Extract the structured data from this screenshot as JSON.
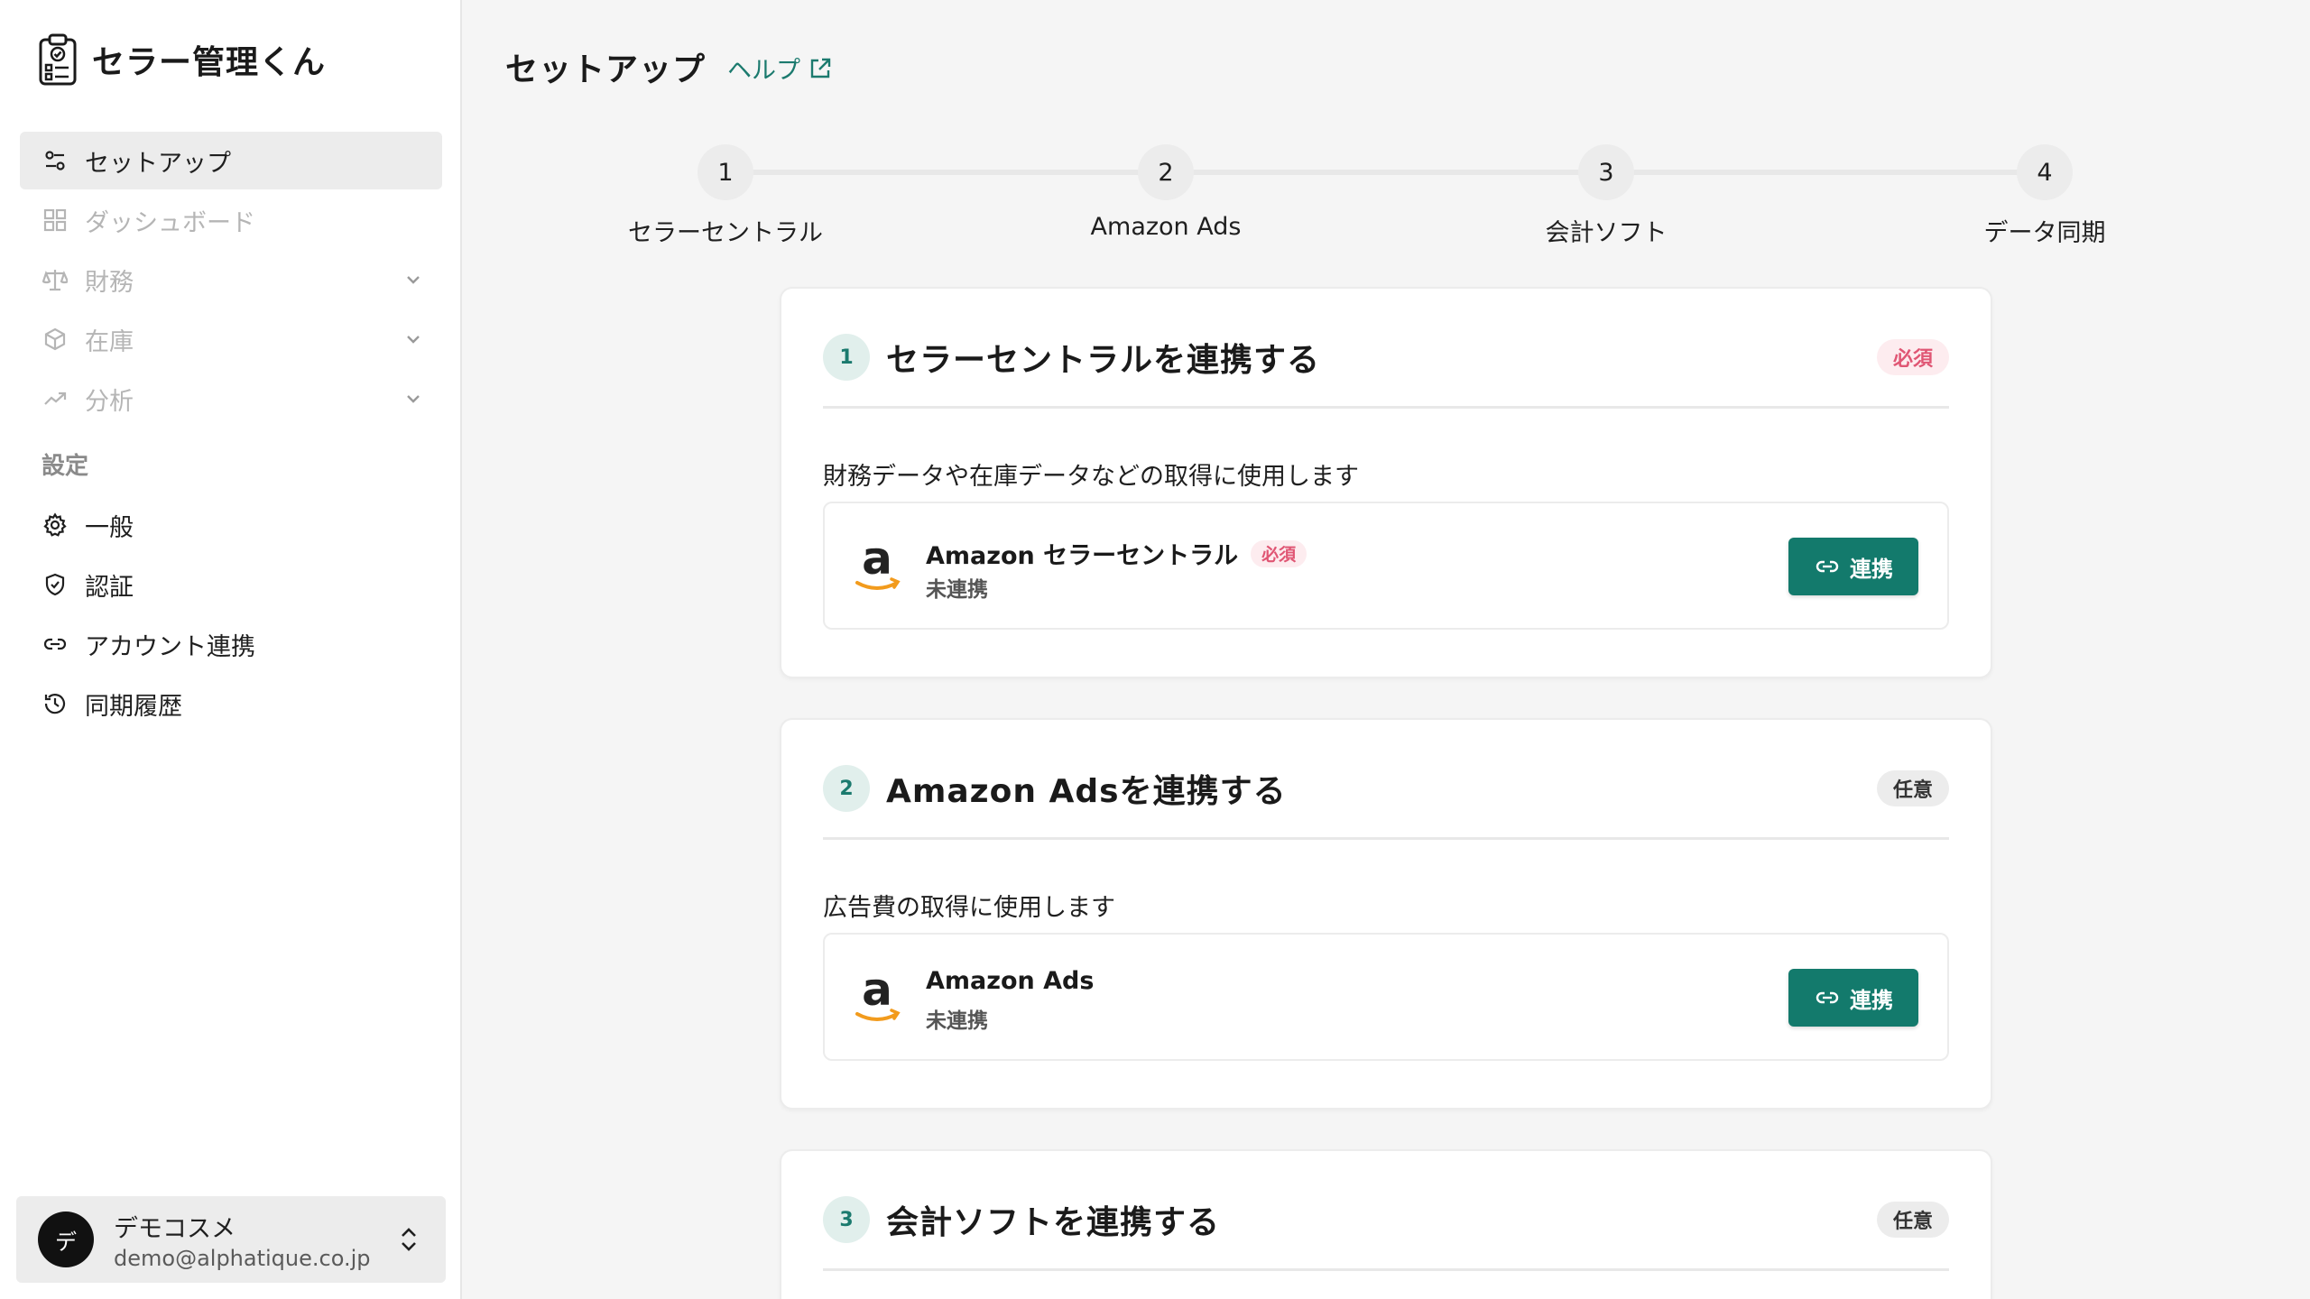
{
  "app": {
    "name": "セラー管理くん"
  },
  "sidebar": {
    "items": [
      {
        "label": "セットアップ",
        "icon": "sliders-icon",
        "state": "active"
      },
      {
        "label": "ダッシュボード",
        "icon": "grid-icon",
        "state": "disabled"
      },
      {
        "label": "財務",
        "icon": "scale-icon",
        "state": "disabled",
        "expandable": true
      },
      {
        "label": "在庫",
        "icon": "box-icon",
        "state": "disabled",
        "expandable": true
      },
      {
        "label": "分析",
        "icon": "trend-icon",
        "state": "disabled",
        "expandable": true
      }
    ],
    "settings_label": "設定",
    "settings_items": [
      {
        "label": "一般",
        "icon": "gear-icon"
      },
      {
        "label": "認証",
        "icon": "shield-icon"
      },
      {
        "label": "アカウント連携",
        "icon": "link-icon"
      },
      {
        "label": "同期履歴",
        "icon": "history-icon"
      }
    ],
    "user": {
      "avatar_initial": "デ",
      "name": "デモコスメ",
      "email": "demo@alphatique.co.jp"
    }
  },
  "header": {
    "title": "セットアップ",
    "help_label": "ヘルプ"
  },
  "stepper": {
    "steps": [
      {
        "number": "1",
        "label": "セラーセントラル"
      },
      {
        "number": "2",
        "label": "Amazon Ads"
      },
      {
        "number": "3",
        "label": "会計ソフト"
      },
      {
        "number": "4",
        "label": "データ同期"
      }
    ]
  },
  "cards": [
    {
      "number": "1",
      "title": "セラーセントラルを連携する",
      "badge": "必須",
      "badge_type": "required",
      "description": "財務データや在庫データなどの取得に使用します",
      "service": {
        "name": "Amazon セラーセントラル",
        "badge": "必須",
        "status": "未連携",
        "button_label": "連携"
      }
    },
    {
      "number": "2",
      "title": "Amazon Adsを連携する",
      "badge": "任意",
      "badge_type": "optional",
      "description": "広告費の取得に使用します",
      "service": {
        "name": "Amazon Ads",
        "status": "未連携",
        "button_label": "連携"
      }
    },
    {
      "number": "3",
      "title": "会計ソフトを連携する",
      "badge": "任意",
      "badge_type": "optional"
    }
  ],
  "colors": {
    "accent": "#137a6c",
    "accent_text": "#1b7a6e",
    "required_badge_bg": "#fdecef",
    "required_badge_text": "#e05674",
    "sidebar_active_bg": "#ececec"
  }
}
